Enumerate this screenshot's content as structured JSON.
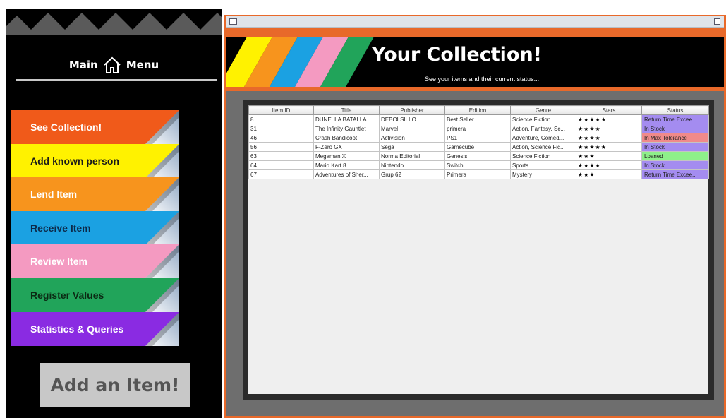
{
  "sidebar": {
    "header": {
      "left": "Main",
      "right": "Menu",
      "icon": "home-icon"
    },
    "buttons": [
      {
        "label": "See Collection!",
        "color": "#f05a1a",
        "text_color": "#ffffff"
      },
      {
        "label": "Add known person",
        "color": "#fff200",
        "text_color": "#1a1a1a"
      },
      {
        "label": "Lend Item",
        "color": "#f7941d",
        "text_color": "#ffffff"
      },
      {
        "label": "Receive Item",
        "color": "#1ba1e2",
        "text_color": "#0d2a4a"
      },
      {
        "label": "Review Item",
        "color": "#f49ac1",
        "text_color": "#ffffff"
      },
      {
        "label": "Register Values",
        "color": "#21a45a",
        "text_color": "#0b2a14"
      },
      {
        "label": "Statistics & Queries",
        "color": "#8a2be2",
        "text_color": "#ffffff"
      }
    ],
    "add_item_label": "Add an Item!"
  },
  "window": {
    "banner": {
      "title": "Your Collection!",
      "subtitle": "See your items and their current status..."
    },
    "stripe_colors": [
      "#fff200",
      "#f7941d",
      "#1ba1e2",
      "#f49ac1",
      "#21a45a"
    ],
    "table": {
      "headers": [
        "Item ID",
        "Title",
        "Publisher",
        "Edition",
        "Genre",
        "Stars",
        "Status"
      ],
      "rows": [
        [
          "8",
          "DUNE. LA BATALLA...",
          "DEBOLSILLO",
          "Best Seller",
          "Science Fiction",
          "★★★★★",
          "Return Time Excee..."
        ],
        [
          "31",
          "The Infinity Gauntlet",
          "Marvel",
          "primera",
          "Action, Fantasy, Sc...",
          "★★★★",
          "In Stock"
        ],
        [
          "46",
          "Crash Bandicoot",
          "Activision",
          "PS1",
          "Adventure, Comed...",
          "★★★★",
          "In Max Tolerance"
        ],
        [
          "56",
          "F-Zero GX",
          "Sega",
          "Gamecube",
          "Action, Science Fic...",
          "★★★★★",
          "In Stock"
        ],
        [
          "63",
          "Megaman X",
          "Norma Editorial",
          "Genesis",
          "Science Fiction",
          "★★★",
          "Loaned"
        ],
        [
          "64",
          "Mario Kart 8",
          "Nintendo",
          "Switch",
          "Sports",
          "★★★★",
          "In Stock"
        ],
        [
          "67",
          "Adventures of Sher...",
          "Grup 62",
          "Primera",
          "Mystery",
          "★★★",
          "Return Time Excee..."
        ]
      ],
      "status_colors": [
        "#a48cf0",
        "#a48cf0",
        "#f08a8a",
        "#a48cf0",
        "#8ef08a",
        "#a48cf0",
        "#a48cf0"
      ]
    }
  }
}
